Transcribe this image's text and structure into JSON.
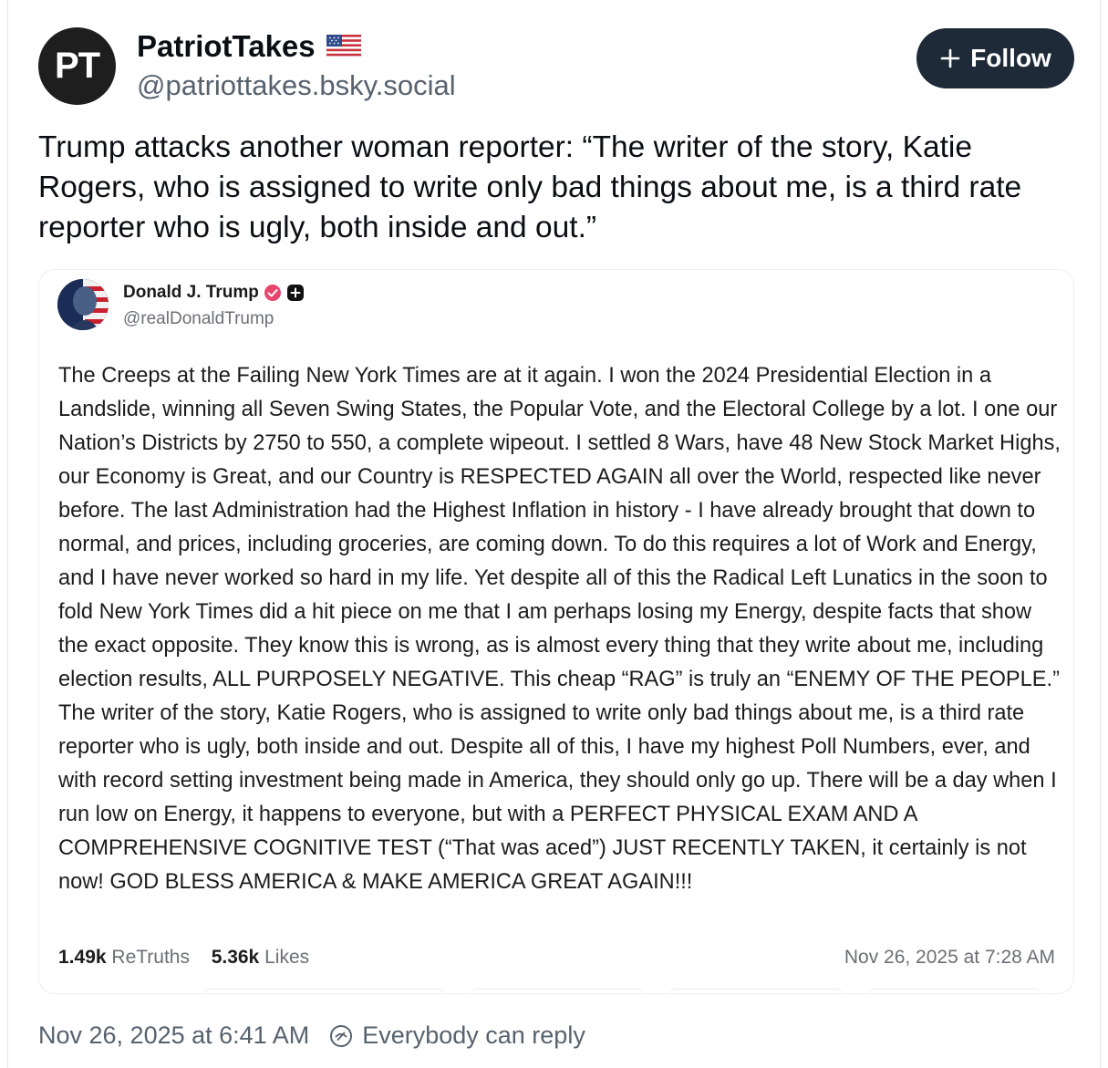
{
  "author": {
    "avatar_text": "PT",
    "display_name": "PatriotTakes",
    "handle": "@patriottakes.bsky.social",
    "flag_icon": "us-flag-icon"
  },
  "follow_button": {
    "label": "Follow",
    "icon": "plus-icon"
  },
  "post_text": "Trump attacks another woman reporter: “The writer of the story, Katie Rogers, who is assigned to write only bad things about me, is a third rate reporter who is ugly, both inside and out.”",
  "embed": {
    "display_name": "Donald J. Trump",
    "handle": "@realDonaldTrump",
    "verified_color": "#e8466e",
    "body": "The Creeps at the Failing New York Times are at it again. I won the 2024 Presidential Election in a Landslide, winning all Seven Swing States, the Popular Vote, and the Electoral College by a lot. I one our Nation’s Districts by 2750 to 550, a complete wipeout. I settled 8 Wars, have 48 New Stock Market Highs, our Economy is Great, and our Country is RESPECTED AGAIN all over the World, respected like never before. The last Administration had the Highest Inflation in history - I have already brought that down to normal, and prices, including groceries, are coming down. To do this requires a lot of Work and Energy, and I have never worked so hard in my life. Yet despite all of this the Radical Left Lunatics in the soon to fold New York Times did a hit piece on me that I am perhaps losing my Energy, despite facts that show the exact opposite. They know this is wrong, as is almost every thing that they write about me, including election results, ALL PURPOSELY NEGATIVE. This cheap “RAG” is truly an “ENEMY OF THE PEOPLE.” The writer of the story, Katie Rogers, who is assigned to write only bad things about me, is a third rate reporter who is ugly, both inside and out. Despite all of this, I have my highest Poll Numbers, ever, and with record setting investment being made in America, they should only go up. There will be a day when I run low on Energy, it happens to everyone, but with a PERFECT PHYSICAL EXAM AND A COMPREHENSIVE COGNITIVE TEST (“That was aced”) JUST RECENTLY TAKEN, it certainly is not now! GOD BLESS AMERICA & MAKE AMERICA GREAT AGAIN!!!",
    "retruths_count": "1.49k",
    "retruths_label": "ReTruths",
    "likes_count": "5.36k",
    "likes_label": "Likes",
    "timestamp": "Nov 26, 2025 at 7:28 AM"
  },
  "footer": {
    "timestamp": "Nov 26, 2025 at 6:41 AM",
    "reply_setting": "Everybody can reply",
    "reply_icon": "reply-restriction-icon"
  }
}
